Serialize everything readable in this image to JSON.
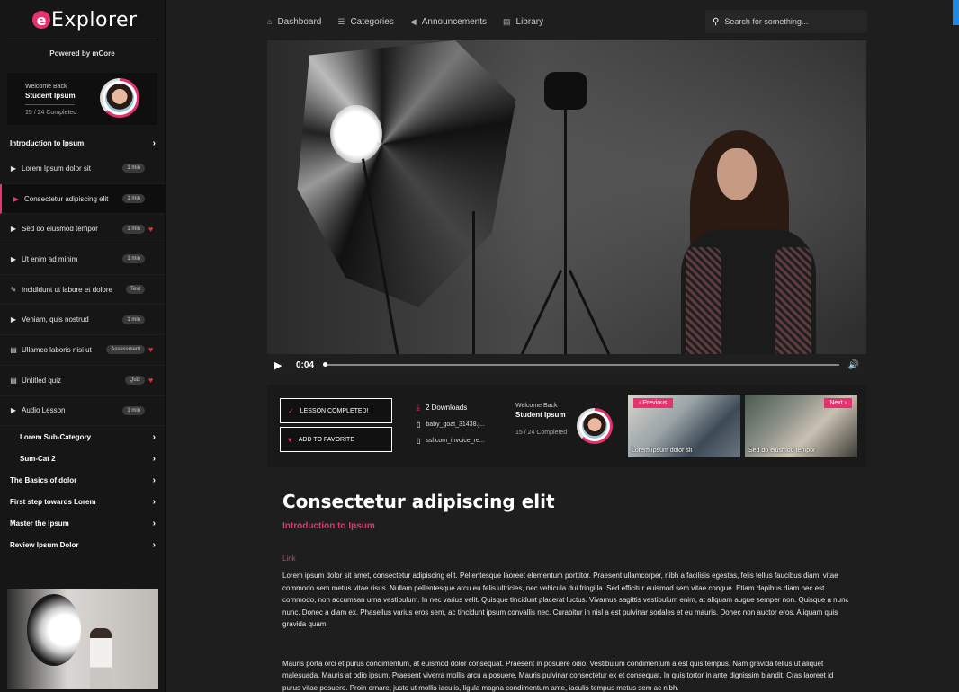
{
  "app": {
    "logo_letter": "e",
    "logo_text": "Explorer",
    "powered_by": "Powered by mCore"
  },
  "user": {
    "welcome": "Welcome Back",
    "name": "Student Ipsum",
    "progress": "15 / 24 Completed",
    "progress_fraction": 0.625
  },
  "sidebar": {
    "section_title": "Introduction to Ipsum",
    "lessons": [
      {
        "icon": "play-icon",
        "title": "Lorem Ipsum dolor sit",
        "badge": "1 min",
        "favorite": false
      },
      {
        "icon": "play-icon",
        "title": "Consectetur adipiscing elit",
        "badge": "1 min",
        "favorite": false,
        "active": true
      },
      {
        "icon": "play-icon",
        "title": "Sed do eiusmod tempor",
        "badge": "1 min",
        "favorite": true
      },
      {
        "icon": "play-icon",
        "title": "Ut enim ad minim",
        "badge": "1 min",
        "favorite": false
      },
      {
        "icon": "pencil-icon",
        "title": "Incididunt ut labore et dolore",
        "badge": "Text",
        "favorite": false
      },
      {
        "icon": "play-icon",
        "title": "Veniam, quis nostrud",
        "badge": "1 min",
        "favorite": false
      },
      {
        "icon": "document-icon",
        "title": "Ullamco laboris nisi ut",
        "badge": "Assessment",
        "favorite": true
      },
      {
        "icon": "document-icon",
        "title": "Untitled quiz",
        "badge": "Quiz",
        "favorite": true
      },
      {
        "icon": "play-icon",
        "title": "Audio Lesson",
        "badge": "1 min",
        "favorite": false
      }
    ],
    "subcategories": [
      "Lorem Sub-Category",
      "Sum-Cat 2"
    ],
    "sections": [
      "The Basics of dolor",
      "First step towards Lorem",
      "Master the Ipsum",
      "Review Ipsum Dolor"
    ]
  },
  "topnav": {
    "items": [
      "Dashboard",
      "Categories",
      "Announcements",
      "Library"
    ],
    "search_placeholder": "Search for something..."
  },
  "video": {
    "time": "0:04",
    "progress_fraction": 0.0
  },
  "actions": {
    "lesson_completed": "LESSON COMPLETED!",
    "add_favorite": "ADD TO FAVORITE"
  },
  "downloads": {
    "title": "2 Downloads",
    "files": [
      "baby_goat_31438.j...",
      "ssl.com_invoice_re..."
    ]
  },
  "navcards": {
    "previous_label": "Previous",
    "previous_title": "Lorem Ipsum dolor sit",
    "next_label": "Next",
    "next_title": "Sed do eiusmod tempor"
  },
  "content": {
    "title": "Consectetur adipiscing elit",
    "category": "Introduction to Ipsum",
    "link": "Link",
    "paragraph1": "Lorem ipsum dolor sit amet, consectetur adipiscing elit. Pellentesque laoreet elementum porttitor. Praesent ullamcorper, nibh a facilisis egestas, felis tellus faucibus diam, vitae commodo sem metus vitae risus. Nullam pellentesque arcu eu felis ultricies, nec vehicula dui fringilla. Sed efficitur euismod sem vitae congue. Etiam dapibus diam nec est commodo, non accumsan urna vestibulum. In nec varius velit. Quisque tincidunt placerat luctus. Vivamus sagittis vestibulum enim, at aliquam augue semper non. Quisque a nunc nunc. Donec a diam ex. Phasellus varius eros sem, ac tincidunt ipsum convallis nec. Curabitur in nisl a est pulvinar sodales et eu mauris. Donec non auctor eros. Aliquam quis gravida quam.",
    "paragraph2": "Mauris porta orci et purus condimentum, at euismod dolor consequat. Praesent in posuere odio. Vestibulum condimentum a est quis tempus. Nam gravida tellus ut aliquet malesuada. Mauris at odio ipsum. Praesent viverra mollis arcu a posuere. Mauris pulvinar consectetur ex et consequat. In quis tortor in ante dignissim blandit. Cras laoreet id purus vitae posuere. Proin ornare, justo ut mollis iaculis, ligula magna condimentum ante, iaculis tempus metus sem ac nibh."
  },
  "colors": {
    "accent": "#e63370",
    "background": "#1e1e1e",
    "sidebar": "#161616"
  }
}
